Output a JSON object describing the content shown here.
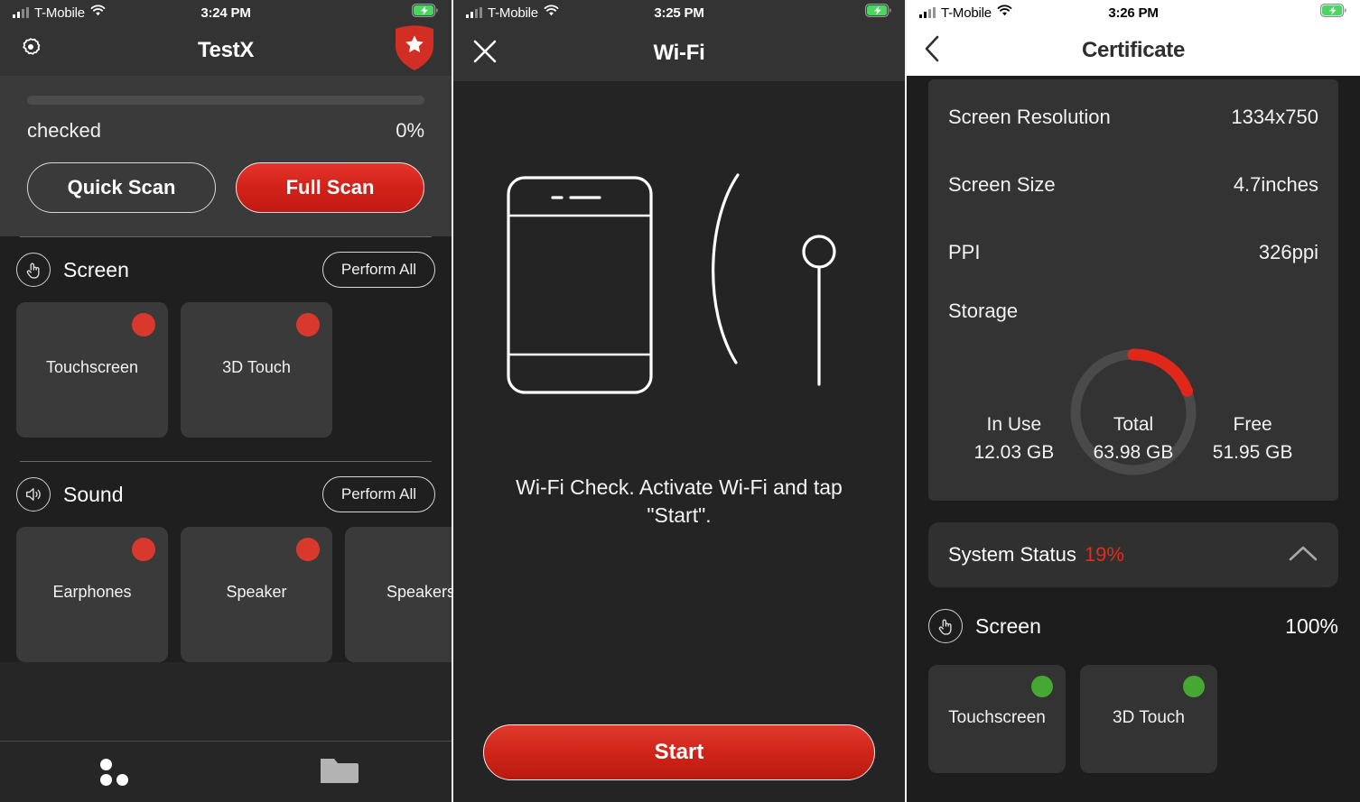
{
  "panel1": {
    "statusbar": {
      "carrier": "T-Mobile",
      "time": "3:24 PM",
      "wifi_icon": "wifi-icon",
      "battery_icon": "battery-charging-icon",
      "signal_icon": "signal-bars-icon"
    },
    "nav": {
      "title": "TestX",
      "settings_icon": "gear-icon",
      "shield_icon": "shield-star-icon"
    },
    "scan": {
      "progress_label": "checked",
      "progress_value": "0%",
      "progress_percent": 0,
      "quick_scan": "Quick Scan",
      "full_scan": "Full Scan"
    },
    "sections": [
      {
        "icon": "touch-gesture-icon",
        "title": "Screen",
        "action": "Perform All",
        "cards": [
          {
            "label": "Touchscreen",
            "status": "fail",
            "dot_color": "#d9392c"
          },
          {
            "label": "3D Touch",
            "status": "fail",
            "dot_color": "#d9392c"
          }
        ]
      },
      {
        "icon": "speaker-icon",
        "title": "Sound",
        "action": "Perform All",
        "cards": [
          {
            "label": "Earphones",
            "status": "fail",
            "dot_color": "#d9392c"
          },
          {
            "label": "Speaker",
            "status": "fail",
            "dot_color": "#d9392c"
          },
          {
            "label": "Speakers",
            "status": "fail",
            "dot_color": "#d9392c"
          }
        ]
      }
    ],
    "tabbar": [
      {
        "name": "tests-tab",
        "icon": "three-dots-icon",
        "active": true
      },
      {
        "name": "files-tab",
        "icon": "folder-icon",
        "active": false
      }
    ]
  },
  "panel2": {
    "statusbar": {
      "carrier": "T-Mobile",
      "time": "3:25 PM",
      "wifi_icon": "wifi-icon",
      "battery_icon": "battery-charging-icon",
      "signal_icon": "signal-bars-icon"
    },
    "nav": {
      "title": "Wi-Fi",
      "close_icon": "close-icon"
    },
    "illustration": "phone-wifi-signal-illustration",
    "instruction": "Wi-Fi Check. Activate Wi-Fi and tap \"Start\".",
    "start_button": "Start"
  },
  "panel3": {
    "statusbar": {
      "carrier": "T-Mobile",
      "time": "3:26 PM",
      "wifi_icon": "wifi-icon",
      "battery_icon": "battery-charging-icon",
      "signal_icon": "signal-bars-icon"
    },
    "nav": {
      "title": "Certificate",
      "back_icon": "chevron-left-icon"
    },
    "specs": [
      {
        "label": "Screen Resolution",
        "value": "1334x750"
      },
      {
        "label": "Screen Size",
        "value": "4.7inches"
      },
      {
        "label": "PPI",
        "value": "326ppi"
      },
      {
        "label": "Storage",
        "value": ""
      }
    ],
    "storage": {
      "in_use_label": "In Use",
      "in_use_value": "12.03 GB",
      "total_label": "Total",
      "total_value": "63.98 GB",
      "free_label": "Free",
      "free_value": "51.95 GB",
      "used_percent": 19,
      "arc_color": "#e0271a",
      "track_color": "#4a4a4a"
    },
    "system_status": {
      "label": "System Status",
      "percent": "19%",
      "percent_color": "#e8291c",
      "chevron_icon": "chevron-up-icon"
    },
    "screen_section": {
      "icon": "touch-gesture-icon",
      "title": "Screen",
      "percent": "100%"
    },
    "screen_cards": [
      {
        "label": "Touchscreen",
        "status": "pass",
        "dot_color": "#45a832"
      },
      {
        "label": "3D Touch",
        "status": "pass",
        "dot_color": "#45a832"
      }
    ]
  },
  "colors": {
    "accent_red": "#d32219",
    "pass_green": "#45a832",
    "fail_red": "#d9392c",
    "panel_bg": "#262626"
  }
}
